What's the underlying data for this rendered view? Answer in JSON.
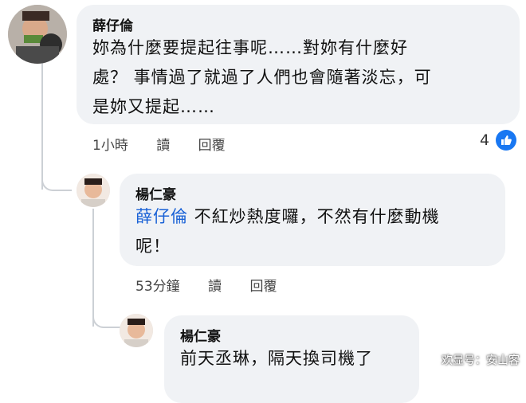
{
  "comments": [
    {
      "author": "薛仔倫",
      "lines": [
        "妳為什麼要提起往事呢……對妳有什麼好",
        "處？  事情過了就過了人們也會隨著淡忘，可",
        "是妳又提起……"
      ],
      "time": "1小時",
      "read_label": "讀",
      "reply_label": "回覆",
      "reaction_count": "4"
    },
    {
      "author": "楊仁豪",
      "mention": "薛仔倫",
      "line1_rest": " 不紅炒熱度囉，不然有什麼動機",
      "line2": "呢！",
      "time": "53分鐘",
      "read_label": "讀",
      "reply_label": "回覆"
    },
    {
      "author": "楊仁豪",
      "line1": "前天丞琳，隔天換司機了"
    }
  ],
  "watermark": "欢显号：安山客",
  "icons": {
    "like": "thumbs-up-icon"
  }
}
